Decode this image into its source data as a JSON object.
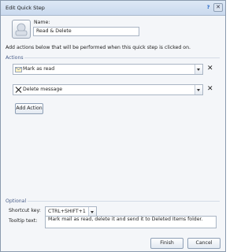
{
  "window": {
    "title": "Edit Quick Step",
    "help_glyph": "?",
    "close_glyph": "✕"
  },
  "name": {
    "label": "Name:",
    "value": "Read & Delete"
  },
  "instructions": "Add actions below that will be performed when this quick step is clicked on.",
  "actions": {
    "title": "Actions",
    "items": [
      {
        "label": "Mark as read",
        "icon": "mark-as-read-icon"
      },
      {
        "label": "Delete message",
        "icon": "delete-x-icon"
      }
    ],
    "remove_glyph": "✕",
    "add_label": "Add Action"
  },
  "optional": {
    "title": "Optional",
    "shortcut_label": "Shortcut key:",
    "shortcut_value": "CTRL+SHIFT+1",
    "tooltip_label": "Tooltip text:",
    "tooltip_value": "Mark mail as read, delete it and send it to Deleted Items folder."
  },
  "buttons": {
    "finish": "Finish",
    "cancel": "Cancel"
  },
  "colors": {
    "section_title": "#4a5f8a",
    "titlebar": "#c9d9ee"
  }
}
